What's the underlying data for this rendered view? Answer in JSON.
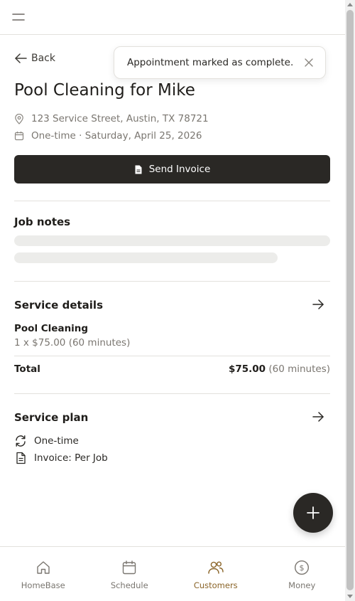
{
  "header": {
    "menu_icon": "hamburger-icon"
  },
  "back": {
    "label": "Back",
    "icon": "arrow-left-icon"
  },
  "job": {
    "title": "Pool Cleaning for Mike",
    "address": "123 Service Street, Austin, TX 78721",
    "schedule": "One-time · Saturday, April 25, 2026",
    "address_icon": "map-pin-icon",
    "schedule_icon": "calendar-icon"
  },
  "send_invoice": {
    "label": "Send Invoice",
    "icon": "document-icon"
  },
  "job_notes": {
    "title": "Job notes"
  },
  "service_details": {
    "title": "Service details",
    "item_name": "Pool Cleaning",
    "item_detail": "1 x $75.00 (60 minutes)",
    "total_label": "Total",
    "total_amount": "$75.00",
    "total_duration": "(60 minutes)"
  },
  "service_plan": {
    "title": "Service plan",
    "frequency": "One-time",
    "invoice": "Invoice: Per Job",
    "frequency_icon": "refresh-icon",
    "invoice_icon": "file-text-icon"
  },
  "toast": {
    "message": "Appointment marked as complete.",
    "close_icon": "close-icon"
  },
  "fab": {
    "icon": "plus-icon"
  },
  "bottom_nav": {
    "items": [
      {
        "label": "HomeBase",
        "icon": "home-icon",
        "active": false
      },
      {
        "label": "Schedule",
        "icon": "calendar-icon",
        "active": false
      },
      {
        "label": "Customers",
        "icon": "users-icon",
        "active": true
      },
      {
        "label": "Money",
        "icon": "dollar-circle-icon",
        "active": false
      }
    ]
  },
  "colors": {
    "primary_button": "#2a2825",
    "accent_active": "#8a6428",
    "muted_text": "#7a7670",
    "divider": "#e3e1dd",
    "skeleton": "#ececea"
  }
}
